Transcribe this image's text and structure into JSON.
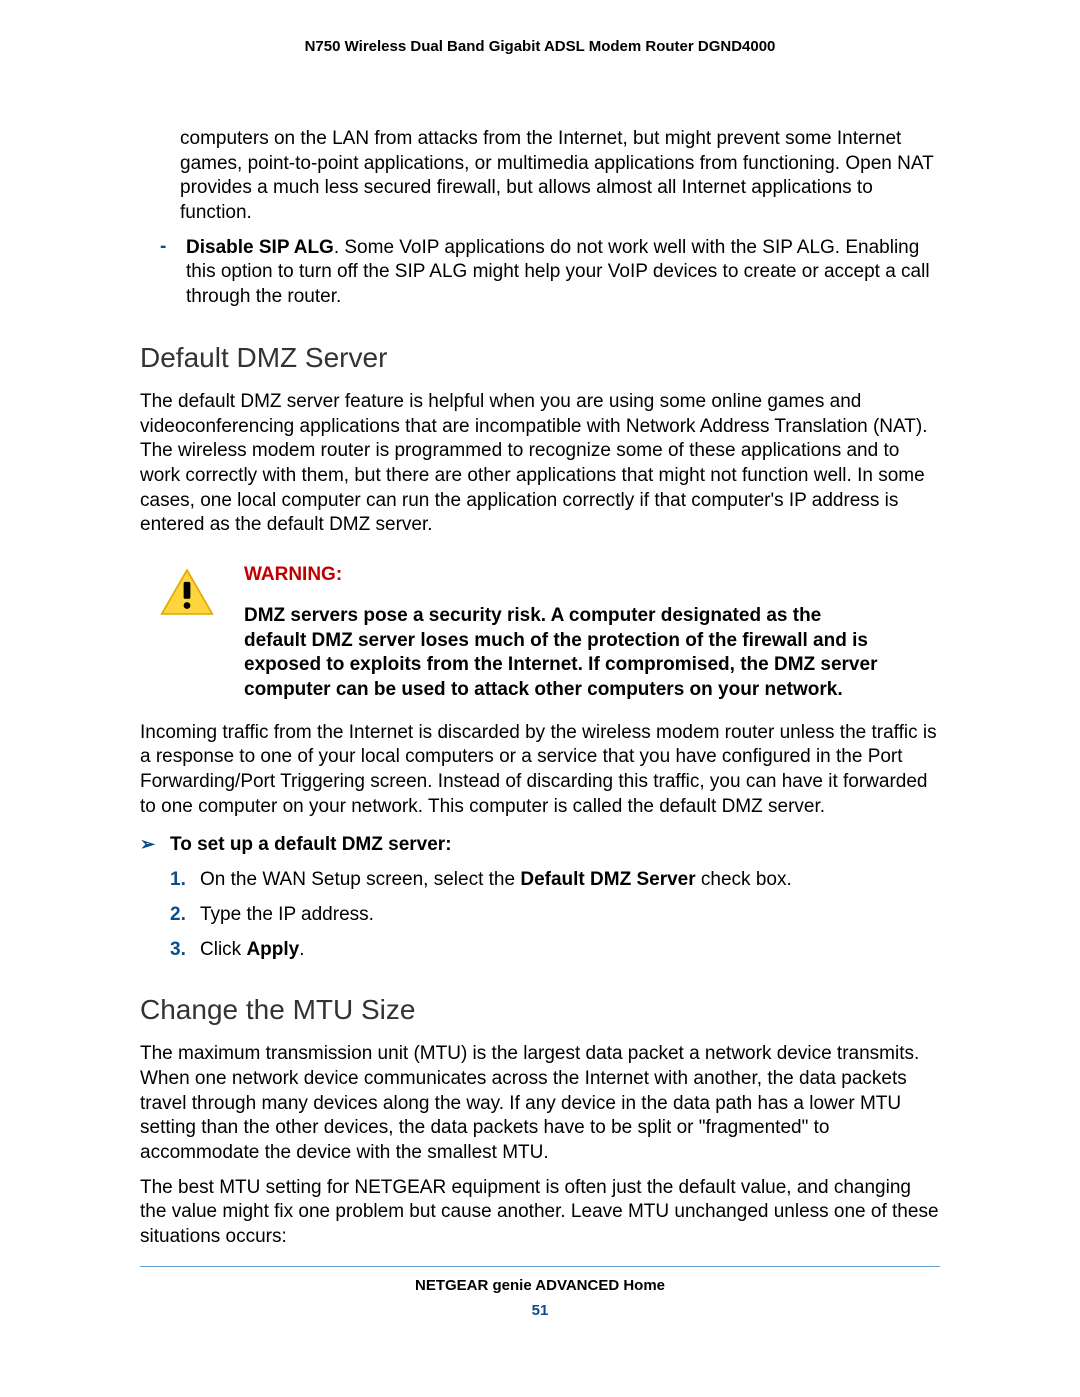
{
  "header": {
    "title": "N750 Wireless Dual Band Gigabit ADSL Modem Router DGND4000"
  },
  "top_paragraph": "computers on the LAN from attacks from the Internet, but might prevent some Internet games, point-to-point applications, or multimedia applications from functioning. Open NAT provides a much less secured firewall, but allows almost all Internet applications to function.",
  "dash_item": {
    "bold_lead": "Disable SIP ALG",
    "rest": ". Some VoIP applications do not work well with the SIP ALG. Enabling this option to turn off the SIP ALG might help your VoIP devices to create or accept a call through the router."
  },
  "section_dmz": {
    "heading": "Default DMZ Server",
    "para1": "The default DMZ server feature is helpful when you are using some online games and videoconferencing applications that are incompatible with Network Address Translation (NAT). The wireless modem router is programmed to recognize some of these applications and to work correctly with them, but there are other applications that might not function well. In some cases, one local computer can run the application correctly if that computer's IP address is entered as the default DMZ server.",
    "warning_label": "WARNING:",
    "warning_text": "DMZ servers pose a security risk. A computer designated as the default DMZ server loses much of the protection of the firewall and is exposed to exploits from the Internet. If compromised, the DMZ server computer can be used to attack other computers on your network.",
    "para2": "Incoming traffic from the Internet is discarded by the wireless modem router unless the traffic is a response to one of your local computers or a service that you have configured in the Port Forwarding/Port Triggering screen. Instead of discarding this traffic, you can have it forwarded to one computer on your network. This computer is called the default DMZ server.",
    "procedure_label": "To set up a default DMZ server:",
    "steps": {
      "s1_pre": "On the WAN Setup screen, select the ",
      "s1_bold": "Default DMZ Server",
      "s1_post": " check box.",
      "s2": "Type the IP address.",
      "s3_pre": "Click ",
      "s3_bold": "Apply",
      "s3_post": "."
    }
  },
  "section_mtu": {
    "heading": "Change the MTU Size",
    "para1": "The maximum transmission unit (MTU) is the largest data packet a network device transmits. When one network device communicates across the Internet with another, the data packets travel through many devices along the way. If any device in the data path has a lower MTU setting than the other devices, the data packets have to be split or \"fragmented\" to accommodate the device with the smallest MTU.",
    "para2": "The best MTU setting for NETGEAR equipment is often just the default value, and changing the value might fix one problem but cause another. Leave MTU unchanged unless one of these situations occurs:"
  },
  "footer": {
    "title": "NETGEAR genie ADVANCED Home",
    "page": "51"
  }
}
